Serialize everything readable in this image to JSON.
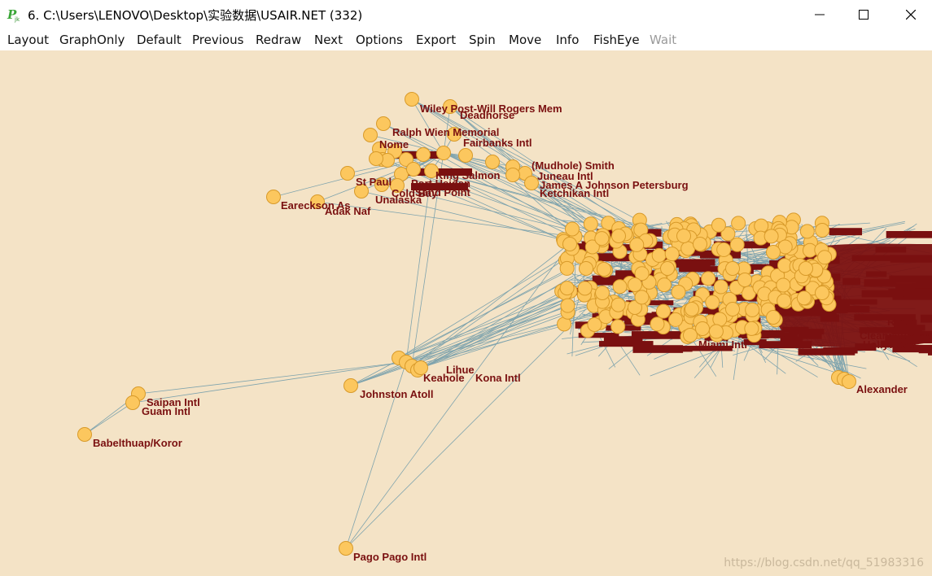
{
  "window": {
    "title": "6. C:\\Users\\LENOVO\\Desktop\\实验数据\\USAIR.NET (332)",
    "icon": "pajek-app-icon",
    "controls": [
      "minimize-icon",
      "maximize-icon",
      "close-icon"
    ]
  },
  "menu": {
    "items": [
      "Layout",
      "GraphOnly",
      "Default",
      "Previous",
      "Redraw",
      "Next",
      "Options",
      "Export",
      "Spin",
      "Move",
      "Info",
      "FishEye",
      "Wait"
    ],
    "disabled": [
      "Wait"
    ]
  },
  "colors": {
    "background": "#f4e3c6",
    "node_fill": "#fcc75e",
    "node_stroke": "#d89a2a",
    "edge": "#7ea3ad",
    "label": "#7a1010"
  },
  "labels": {
    "wiley_post": "Wiley Post-Will Rogers Mem",
    "deadhorse": "Deadhorse",
    "ralph_wien": "Ralph Wien Memorial",
    "nome": "Nome",
    "fairbanks": "Fairbanks Intl",
    "mudhole": "(Mudhole) Smith",
    "king_salmon": "King Salmon",
    "port_heiden": "Port Heiden",
    "cold_bay": "Cold Bay",
    "sand_point": "Sand Point",
    "unalaska": "Unalaska",
    "st_paul": "St Paul",
    "eareckson": "Eareckson As",
    "adak": "Adak Naf",
    "petersburg": "James A Johnson Petersburg",
    "ketchikan": "Ketchikan Intl",
    "juneau": "Juneau Intl",
    "johnston": "Johnston Atoll",
    "kona": "Kona Intl",
    "keahole": "Keahole",
    "lihue": "Lihue",
    "guam": "Guam Intl",
    "saipan": "Saipan Intl",
    "babelthuap": "Babelthuap/Koror",
    "pago": "Pago Pago Intl",
    "ryan": "Ryan",
    "clearwater": "Clearwater Intl",
    "hollywood": "Hollywood",
    "miami": "Miami Intl",
    "alexander": "Alexander"
  },
  "watermark": "https://blog.csdn.net/qq_51983316"
}
